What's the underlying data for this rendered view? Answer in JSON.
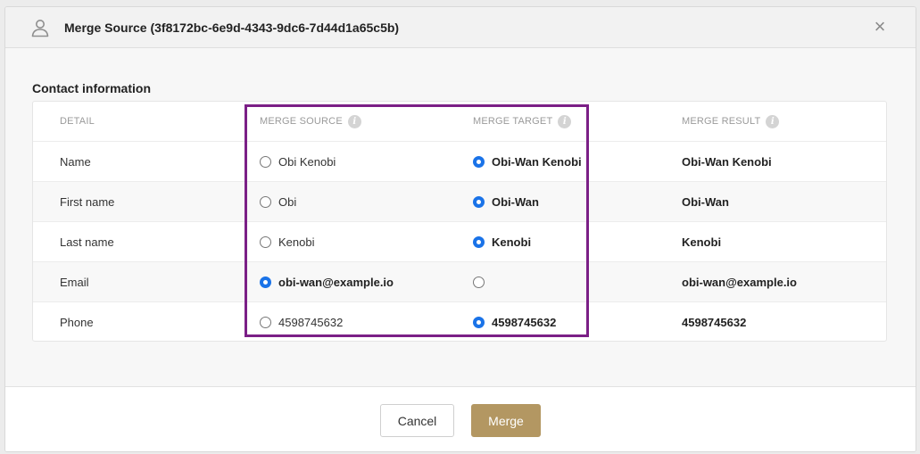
{
  "modal": {
    "title": "Merge Source (3f8172bc-6e9d-4343-9dc6-7d44d1a65c5b)",
    "close_symbol": "×"
  },
  "section": {
    "title": "Contact information"
  },
  "table": {
    "headers": {
      "detail": "DETAIL",
      "source": "MERGE SOURCE",
      "target": "MERGE TARGET",
      "result": "MERGE RESULT",
      "info_symbol": "i"
    },
    "rows": [
      {
        "detail": "Name",
        "source": "Obi Kenobi",
        "target": "Obi-Wan Kenobi",
        "result": "Obi-Wan Kenobi",
        "selected": "target"
      },
      {
        "detail": "First name",
        "source": "Obi",
        "target": "Obi-Wan",
        "result": "Obi-Wan",
        "selected": "target"
      },
      {
        "detail": "Last name",
        "source": "Kenobi",
        "target": "Kenobi",
        "result": "Kenobi",
        "selected": "target"
      },
      {
        "detail": "Email",
        "source": "obi-wan@example.io",
        "target": "",
        "result": "obi-wan@example.io",
        "selected": "source"
      },
      {
        "detail": "Phone",
        "source": "4598745632",
        "target": "4598745632",
        "result": "4598745632",
        "selected": "target"
      }
    ]
  },
  "footer": {
    "cancel_label": "Cancel",
    "merge_label": "Merge"
  },
  "colors": {
    "highlight_border": "#7b1f86",
    "merge_button": "#b39762",
    "radio_checked": "#1a73e8"
  },
  "icons": {
    "header": "user-icon",
    "close": "close-icon",
    "info": "info-icon"
  }
}
